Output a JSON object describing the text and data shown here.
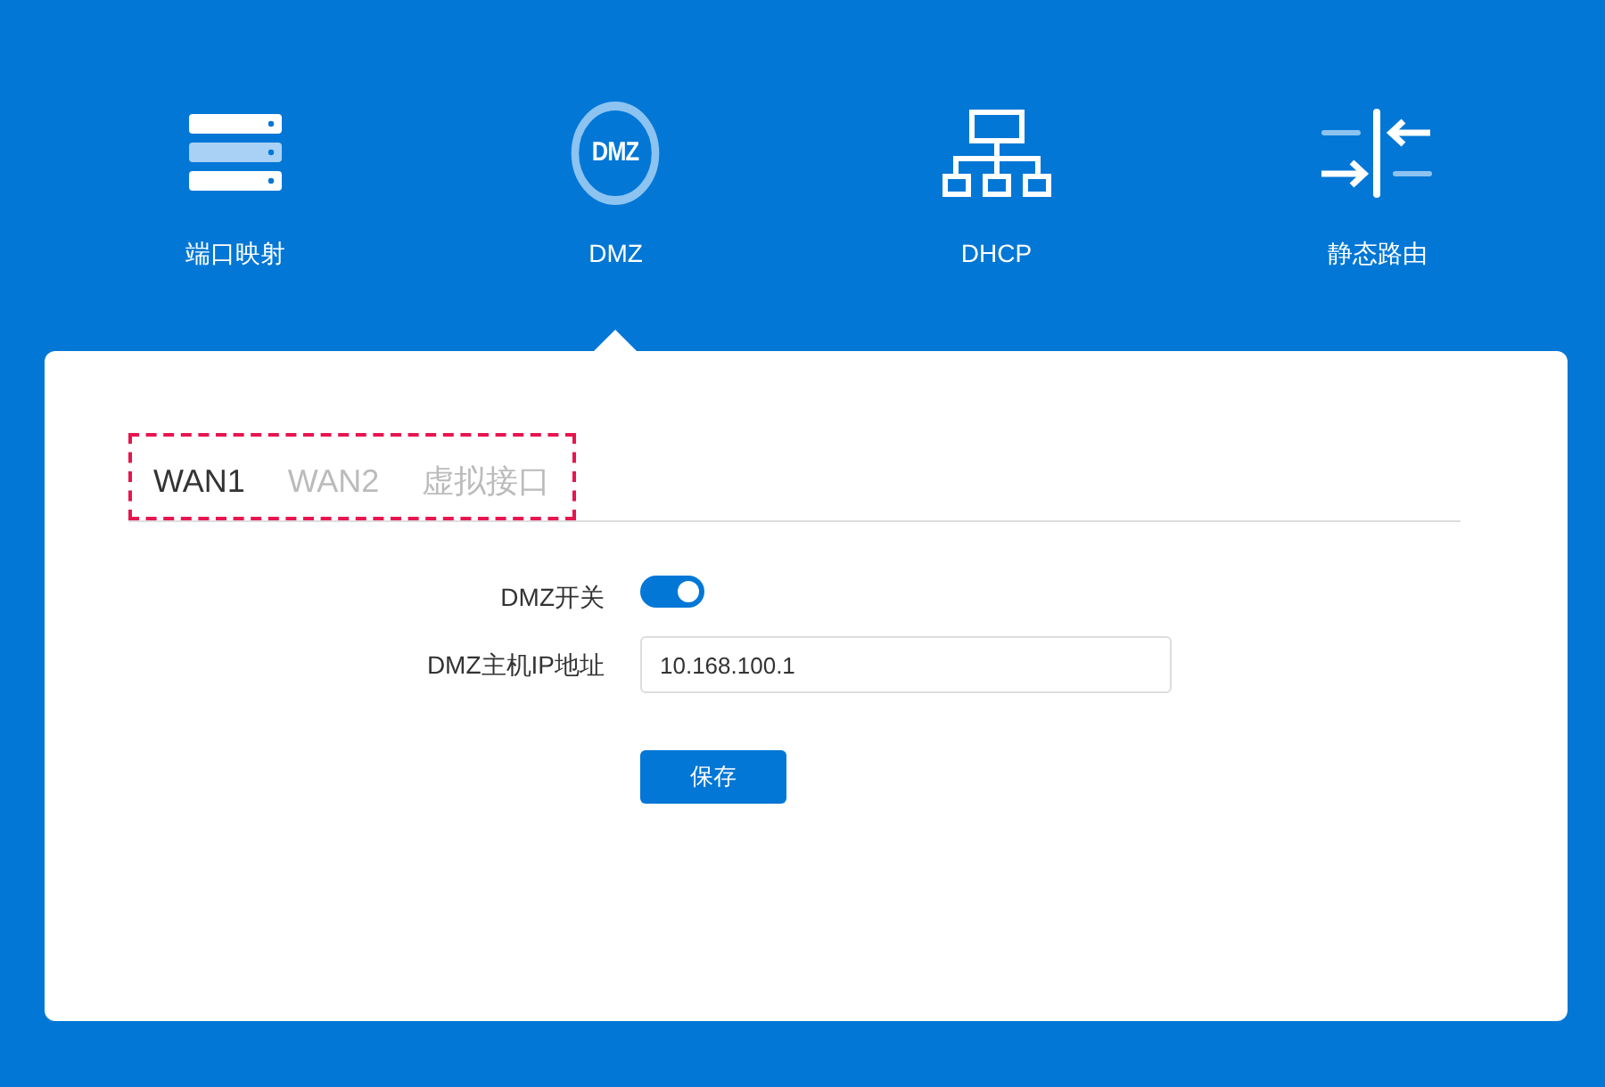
{
  "nav": [
    {
      "kind": "server",
      "label": "端口映射",
      "selected": false
    },
    {
      "kind": "badge",
      "label": "DMZ",
      "icon_text": "DMZ",
      "selected": true
    },
    {
      "kind": "network",
      "label": "DHCP",
      "selected": false
    },
    {
      "kind": "route",
      "label": "静态路由",
      "selected": false
    }
  ],
  "tabs_highlighted": true,
  "tabs": [
    {
      "label": "WAN1",
      "selected": true
    },
    {
      "label": "WAN2",
      "selected": false
    },
    {
      "label": "虚拟接口",
      "selected": false
    }
  ],
  "form": {
    "switch_label": "DMZ开关",
    "switch_on": true,
    "ip_label": "DMZ主机IP地址",
    "ip_value": "10.168.100.1",
    "save": "保存"
  }
}
